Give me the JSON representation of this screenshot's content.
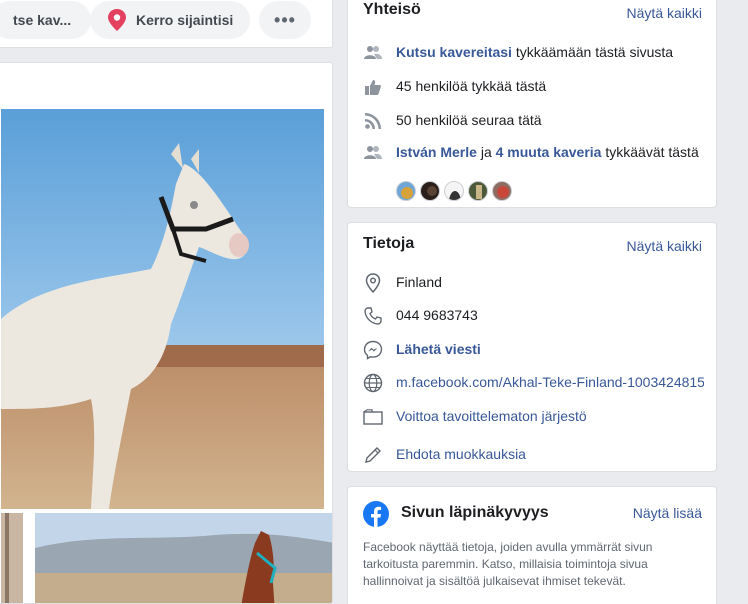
{
  "top_actions": {
    "message_label": "tse kav...",
    "location_label": "Kerro sijaintisi",
    "more_label": "•••"
  },
  "community": {
    "title": "Yhteisö",
    "see_all": "Näytä kaikki",
    "invite_link": "Kutsu kavereitasi",
    "invite_suffix": " tykkäämään tästä sivusta",
    "likes_text": "45 henkilöä tykkää tästä",
    "follows_text": "50 henkilöä seuraa tätä",
    "friend_name": "István Merle",
    "friend_and": " ja ",
    "friend_others": "4 muuta kaveria",
    "friend_suffix": " tykkäävät tästä"
  },
  "about": {
    "title": "Tietoja",
    "see_all": "Näytä kaikki",
    "location": "Finland",
    "phone": "044 9683743",
    "send_message": "Lähetä viesti",
    "website": "m.facebook.com/Akhal-Teke-Finland-1003424815",
    "category": "Voittoa tavoittelematon järjestö",
    "suggest_edits": "Ehdota muokkauksia"
  },
  "transparency": {
    "title": "Sivun läpinäkyvyys",
    "see_more": "Näytä lisää",
    "description": "Facebook näyttää tietoja, joiden avulla ymmärrät sivun tarkoitusta paremmin. Katso, millaisia toimintoja sivua hallinnoivat ja sisältöä julkaisevat ihmiset tekevät."
  },
  "colors": {
    "link": "#385898",
    "facebook_blue": "#1877f2",
    "background": "#e9ebee"
  }
}
